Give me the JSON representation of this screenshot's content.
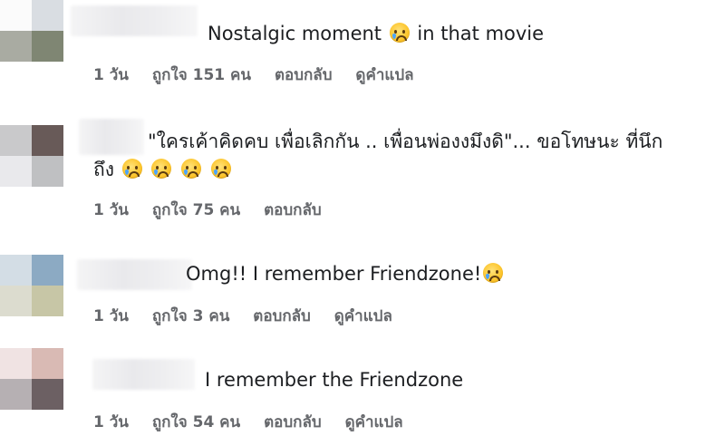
{
  "comments": [
    {
      "text": "Nostalgic moment",
      "text_after": "in that movie",
      "meta": {
        "time": "1 วัน",
        "likes": "ถูกใจ 151 คน",
        "reply": "ตอบกลับ",
        "translate": "ดูคำแปล"
      }
    },
    {
      "text": "\"ใครเค้าคิดคบ เพื่อเลิกกัน .. เพื่อนพ่องงมึงดิ\"... ขอโทษนะ ที่นึก",
      "text_line2": "ถึง",
      "meta": {
        "time": "1 วัน",
        "likes": "ถูกใจ 75 คน",
        "reply": "ตอบกลับ"
      }
    },
    {
      "text": "Omg!! I remember Friendzone!",
      "meta": {
        "time": "1 วัน",
        "likes": "ถูกใจ 3 คน",
        "reply": "ตอบกลับ",
        "translate": "ดูคำแปล"
      }
    },
    {
      "text": "I remember the Friendzone",
      "meta": {
        "time": "1 วัน",
        "likes": "ถูกใจ 54 คน",
        "reply": "ตอบกลับ",
        "translate": "ดูคำแปล"
      }
    }
  ],
  "icons": {
    "reaction": "crying-face-icon"
  },
  "colors": {
    "text": "#1c1e21",
    "meta": "#65676b"
  }
}
